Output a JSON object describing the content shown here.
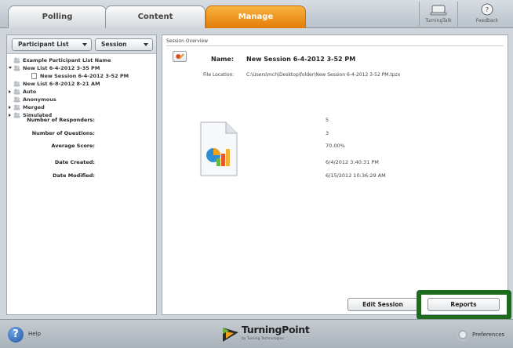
{
  "tabs": [
    {
      "label": "Polling",
      "active": false
    },
    {
      "label": "Content",
      "active": false
    },
    {
      "label": "Manage",
      "active": true
    }
  ],
  "toolbar": {
    "turningtalk_label": "TurningTalk",
    "feedback_label": "Feedback"
  },
  "left_pane": {
    "participant_list_dropdown": "Participant List",
    "session_dropdown": "Session",
    "tree": [
      {
        "label": "Example Participant List Name",
        "expander": "none",
        "level": 0
      },
      {
        "label": "New List 6-4-2012 3-35 PM",
        "expander": "open",
        "level": 0
      },
      {
        "label": "New Session 6-4-2012 3-52 PM",
        "expander": "none",
        "level": 1,
        "selected": true
      },
      {
        "label": "New List 6-8-2012 8-21 AM",
        "expander": "none",
        "level": 0
      },
      {
        "label": "Auto",
        "expander": "closed",
        "level": 0
      },
      {
        "label": "Anonymous",
        "expander": "none",
        "level": 0
      },
      {
        "label": "Merged",
        "expander": "closed",
        "level": 0
      },
      {
        "label": "Simulated",
        "expander": "closed",
        "level": 0
      }
    ]
  },
  "session_overview": {
    "title": "Session Overview",
    "name_label": "Name:",
    "name_value": "New Session 6-4-2012 3-52 PM",
    "file_location_label": "File Location:",
    "file_location_value": "C:\\Users\\mch\\Desktop\\folder\\New Session 6-4-2012 3-52 PM.tpzx",
    "responders_label": "Number of Responders:",
    "responders_value": "5",
    "questions_label": "Number of Questions:",
    "questions_value": "3",
    "avg_score_label": "Average Score:",
    "avg_score_value": "70.00%",
    "date_created_label": "Date Created:",
    "date_created_value": "6/4/2012 3:40:31 PM",
    "date_modified_label": "Date Modified:",
    "date_modified_value": "6/15/2012 10:36:29 AM",
    "edit_session_button": "Edit Session",
    "reports_button": "Reports"
  },
  "bottom": {
    "help_label": "Help",
    "logo_text": "TurningPoint",
    "logo_sub": "by Turning Technologies",
    "preferences_label": "Preferences"
  },
  "colors": {
    "active_tab": "#f0960f",
    "highlight_box": "#1d6b1d"
  }
}
